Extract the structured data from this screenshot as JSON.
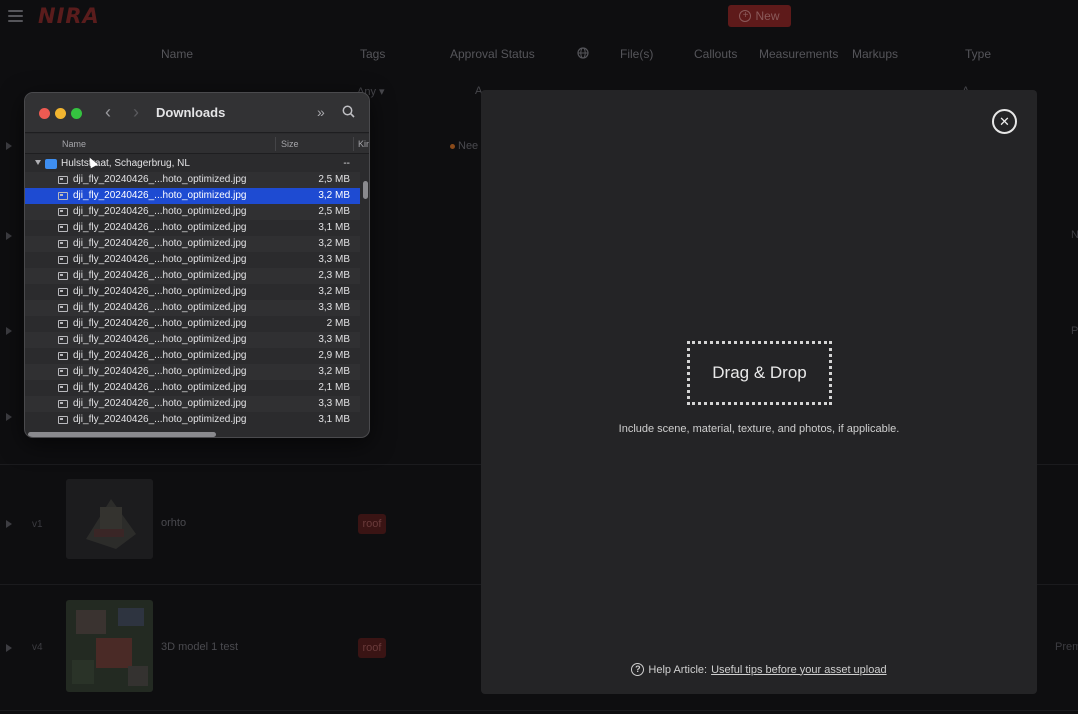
{
  "app": {
    "logo": "NIRA",
    "new_button": "New"
  },
  "columns": [
    "Name",
    "Tags",
    "Approval Status",
    "File(s)",
    "Callouts",
    "Measurements",
    "Markups",
    "Type"
  ],
  "filters": {
    "tags": "Any ▾",
    "approval": "A",
    "type": "A"
  },
  "rows": [
    {
      "status": "Nee"
    },
    {
      "side": "N"
    },
    {
      "side": "P"
    },
    {
      "version": "v1",
      "name": "orhto",
      "tag": "roof"
    },
    {
      "version": "v4",
      "name": "3D model 1 test",
      "tag": "roof",
      "side": "Prem"
    }
  ],
  "modal": {
    "dropzone": "Drag & Drop",
    "hint": "Include scene, material, texture, and photos, if applicable.",
    "help_prefix": "Help Article:",
    "help_link": "Useful tips before your asset upload"
  },
  "finder": {
    "title": "Downloads",
    "headers": {
      "name": "Name",
      "size": "Size",
      "kind": "Kin"
    },
    "folder": {
      "name": "Hulststraat, Schagerbrug, NL",
      "size": "--"
    },
    "files": [
      {
        "name": "dji_fly_20240426_...hoto_optimized.jpg",
        "size": "2,5 MB"
      },
      {
        "name": "dji_fly_20240426_...hoto_optimized.jpg",
        "size": "3,2 MB"
      },
      {
        "name": "dji_fly_20240426_...hoto_optimized.jpg",
        "size": "2,5 MB"
      },
      {
        "name": "dji_fly_20240426_...hoto_optimized.jpg",
        "size": "3,1 MB"
      },
      {
        "name": "dji_fly_20240426_...hoto_optimized.jpg",
        "size": "3,2 MB"
      },
      {
        "name": "dji_fly_20240426_...hoto_optimized.jpg",
        "size": "3,3 MB"
      },
      {
        "name": "dji_fly_20240426_...hoto_optimized.jpg",
        "size": "2,3 MB"
      },
      {
        "name": "dji_fly_20240426_...hoto_optimized.jpg",
        "size": "3,2 MB"
      },
      {
        "name": "dji_fly_20240426_...hoto_optimized.jpg",
        "size": "3,3 MB"
      },
      {
        "name": "dji_fly_20240426_...hoto_optimized.jpg",
        "size": "2 MB"
      },
      {
        "name": "dji_fly_20240426_...hoto_optimized.jpg",
        "size": "3,3 MB"
      },
      {
        "name": "dji_fly_20240426_...hoto_optimized.jpg",
        "size": "2,9 MB"
      },
      {
        "name": "dji_fly_20240426_...hoto_optimized.jpg",
        "size": "3,2 MB"
      },
      {
        "name": "dji_fly_20240426_...hoto_optimized.jpg",
        "size": "2,1 MB"
      },
      {
        "name": "dji_fly_20240426_...hoto_optimized.jpg",
        "size": "3,3 MB"
      },
      {
        "name": "dji_fly_20240426_...hoto_optimized.jpg",
        "size": "3,1 MB"
      }
    ],
    "selected_index": 1
  },
  "colors": {
    "accent": "#5e1a1a",
    "selection": "#1e4bd2",
    "modal_bg": "#242426"
  },
  "icons": [
    "menu-icon",
    "plus-circle-icon",
    "globe-icon",
    "close-icon",
    "help-icon",
    "search-icon",
    "back-icon",
    "forward-icon",
    "more-icon",
    "folder-icon",
    "image-file-icon"
  ]
}
